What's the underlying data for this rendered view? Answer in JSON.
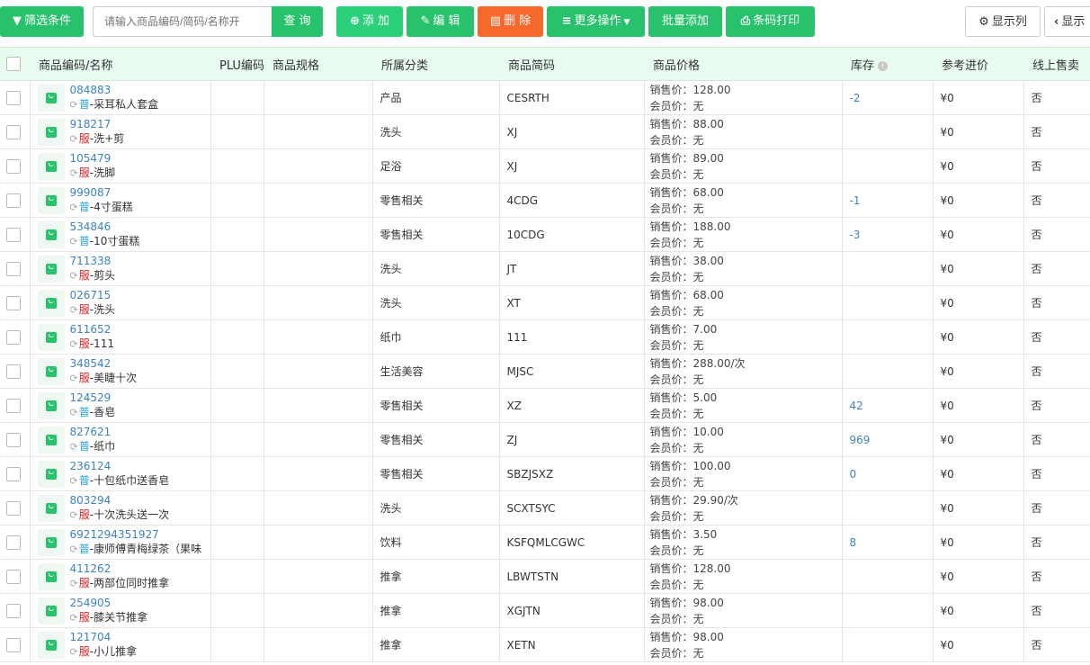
{
  "toolbar": {
    "filter_label": "筛选条件",
    "search_placeholder": "请输入商品编码/简码/名称开",
    "query_label": "查 询",
    "add_label": "添 加",
    "edit_label": "编 辑",
    "delete_label": "删 除",
    "more_label": "更多操作",
    "batch_add_label": "批量添加",
    "barcode_print_label": "条码打印",
    "show_columns_label": "显示列",
    "show_label": "显示"
  },
  "columns": [
    "商品编码/名称",
    "PLU编码",
    "商品规格",
    "所属分类",
    "商品简码",
    "商品价格",
    "库存",
    "参考进价",
    "线上售卖"
  ],
  "price_labels": {
    "sale": "销售价：",
    "member": "会员价："
  },
  "currency": "¥",
  "colors": {
    "green": "#27c26b",
    "orange": "#f7682b",
    "link": "#3d82c4",
    "tag_common": "#29a3e6",
    "tag_service": "#e02020"
  },
  "rows": [
    {
      "code": "084883",
      "tag": "普",
      "name": "-采耳私人套盒",
      "category": "产品",
      "short": "CESRTH",
      "sale": "128.00",
      "member": "无",
      "stock": "-2",
      "cost": "0",
      "online": "否"
    },
    {
      "code": "918217",
      "tag": "服",
      "name": "-洗+剪",
      "category": "洗头",
      "short": "XJ",
      "sale": "88.00",
      "member": "无",
      "stock": "",
      "cost": "0",
      "online": "否"
    },
    {
      "code": "105479",
      "tag": "服",
      "name": "-洗脚",
      "category": "足浴",
      "short": "XJ",
      "sale": "89.00",
      "member": "无",
      "stock": "",
      "cost": "0",
      "online": "否"
    },
    {
      "code": "999087",
      "tag": "普",
      "name": "-4寸蛋糕",
      "category": "零售相关",
      "short": "4CDG",
      "sale": "68.00",
      "member": "无",
      "stock": "-1",
      "cost": "0",
      "online": "否"
    },
    {
      "code": "534846",
      "tag": "普",
      "name": "-10寸蛋糕",
      "category": "零售相关",
      "short": "10CDG",
      "sale": "188.00",
      "member": "无",
      "stock": "-3",
      "cost": "0",
      "online": "否"
    },
    {
      "code": "711338",
      "tag": "服",
      "name": "-剪头",
      "category": "洗头",
      "short": "JT",
      "sale": "38.00",
      "member": "无",
      "stock": "",
      "cost": "0",
      "online": "否"
    },
    {
      "code": "026715",
      "tag": "服",
      "name": "-洗头",
      "category": "洗头",
      "short": "XT",
      "sale": "68.00",
      "member": "无",
      "stock": "",
      "cost": "0",
      "online": "否"
    },
    {
      "code": "611652",
      "tag": "服",
      "name": "-111",
      "category": "纸巾",
      "short": "111",
      "sale": "7.00",
      "member": "无",
      "stock": "",
      "cost": "0",
      "online": "否"
    },
    {
      "code": "348542",
      "tag": "服",
      "name": "-美睫十次",
      "category": "生活美容",
      "short": "MJSC",
      "sale": "288.00/次",
      "member": "无",
      "stock": "",
      "cost": "0",
      "online": "否"
    },
    {
      "code": "124529",
      "tag": "普",
      "name": "-香皂",
      "category": "零售相关",
      "short": "XZ",
      "sale": "5.00",
      "member": "无",
      "stock": "42",
      "cost": "0",
      "online": "否"
    },
    {
      "code": "827621",
      "tag": "普",
      "name": "-纸巾",
      "category": "零售相关",
      "short": "ZJ",
      "sale": "10.00",
      "member": "无",
      "stock": "969",
      "cost": "0",
      "online": "否"
    },
    {
      "code": "236124",
      "tag": "普",
      "name": "-十包纸巾送香皂",
      "category": "零售相关",
      "short": "SBZJSXZ",
      "sale": "100.00",
      "member": "无",
      "stock": "0",
      "cost": "0",
      "online": "否"
    },
    {
      "code": "803294",
      "tag": "服",
      "name": "-十次洗头送一次",
      "category": "洗头",
      "short": "SCXTSYC",
      "sale": "29.90/次",
      "member": "无",
      "stock": "",
      "cost": "0",
      "online": "否"
    },
    {
      "code": "6921294351927",
      "tag": "普",
      "name": "-康师傅青梅绿茶（果味",
      "category": "饮料",
      "short": "KSFQMLCGWC",
      "sale": "3.50",
      "member": "无",
      "stock": "8",
      "cost": "0",
      "online": "否"
    },
    {
      "code": "411262",
      "tag": "服",
      "name": "-两部位同时推拿",
      "category": "推拿",
      "short": "LBWTSTN",
      "sale": "128.00",
      "member": "无",
      "stock": "",
      "cost": "0",
      "online": "否"
    },
    {
      "code": "254905",
      "tag": "服",
      "name": "-膝关节推拿",
      "category": "推拿",
      "short": "XGJTN",
      "sale": "98.00",
      "member": "无",
      "stock": "",
      "cost": "0",
      "online": "否"
    },
    {
      "code": "121704",
      "tag": "服",
      "name": "-小儿推拿",
      "category": "推拿",
      "short": "XETN",
      "sale": "98.00",
      "member": "无",
      "stock": "",
      "cost": "0",
      "online": "否"
    }
  ]
}
